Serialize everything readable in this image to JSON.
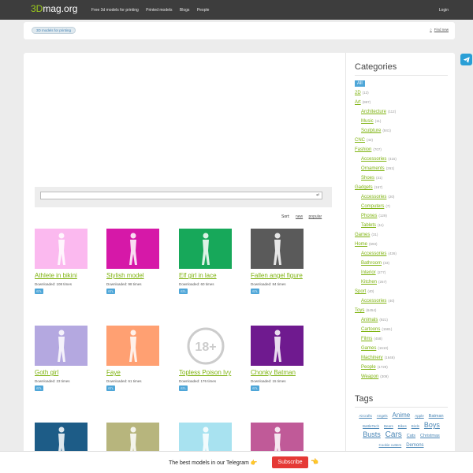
{
  "header": {
    "logo_prefix": "3D",
    "logo_rest": "mag.org",
    "nav": [
      "Free 3d models for printing",
      "Printed models",
      "Blogs",
      "People"
    ],
    "login": "Login"
  },
  "breadcrumb": {
    "item": "3D models for printing",
    "find_new": "Find new"
  },
  "search": {
    "placeholder": ""
  },
  "sort": {
    "label": "Sort:",
    "options": [
      "new",
      "popular"
    ]
  },
  "cards": [
    {
      "title": "Athlete in bikini",
      "downloads": "Downloaded: 108 times",
      "badge": "STL",
      "color": "#fbb9ef",
      "icon": "figure"
    },
    {
      "title": "Stylish model",
      "downloads": "Downloaded: 98 times",
      "badge": "STL",
      "color": "#d618a8",
      "icon": "figure"
    },
    {
      "title": "Elf girl in lace",
      "downloads": "Downloaded: 60 times",
      "badge": "STL",
      "color": "#17a85a",
      "icon": "figure"
    },
    {
      "title": "Fallen angel figure",
      "downloads": "Downloaded: 84 times",
      "badge": "STL",
      "color": "#5a5a5a",
      "icon": "figure"
    },
    {
      "title": "Goth girl",
      "downloads": "Downloaded: 23 times",
      "badge": "STL",
      "color": "#b4a8e0",
      "icon": "figure"
    },
    {
      "title": "Faye",
      "downloads": "Downloaded: 61 times",
      "badge": "STL",
      "color": "#ffa072",
      "icon": "figure"
    },
    {
      "title": "Topless Poison Ivy",
      "downloads": "Downloaded: 176 times",
      "badge": "STL",
      "color": "#ffffff",
      "icon": "18plus"
    },
    {
      "title": "Chonky Batman",
      "downloads": "Downloaded: 15 times",
      "badge": "STL",
      "color": "#6f1a8f",
      "icon": "figure"
    },
    {
      "title": "",
      "downloads": "",
      "badge": "",
      "color": "#1d5c87",
      "icon": "figure"
    },
    {
      "title": "",
      "downloads": "",
      "badge": "",
      "color": "#b7b57d",
      "icon": "figure"
    },
    {
      "title": "",
      "downloads": "",
      "badge": "",
      "color": "#a8e2f0",
      "icon": "figure"
    },
    {
      "title": "",
      "downloads": "",
      "badge": "",
      "color": "#c05a98",
      "icon": "figure"
    }
  ],
  "age_badge": "18+",
  "categories": {
    "title": "Categories",
    "items": [
      {
        "name": "All",
        "count": "",
        "level": 1,
        "all": true
      },
      {
        "name": "2D",
        "count": "(12)",
        "level": 1
      },
      {
        "name": "Art",
        "count": "(987)",
        "level": 1
      },
      {
        "name": "Architecture",
        "count": "(112)",
        "level": 2
      },
      {
        "name": "Music",
        "count": "(11)",
        "level": 2
      },
      {
        "name": "Sculpture",
        "count": "(841)",
        "level": 2
      },
      {
        "name": "CNC",
        "count": "(42)",
        "level": 1
      },
      {
        "name": "Fashion",
        "count": "(707)",
        "level": 1
      },
      {
        "name": "Accessories",
        "count": "(415)",
        "level": 2
      },
      {
        "name": "Ornaments",
        "count": "(261)",
        "level": 2
      },
      {
        "name": "Shoes",
        "count": "(31)",
        "level": 2
      },
      {
        "name": "Gadgets",
        "count": "(167)",
        "level": 1
      },
      {
        "name": "Accessories",
        "count": "(20)",
        "level": 2
      },
      {
        "name": "Computers",
        "count": "(7)",
        "level": 2
      },
      {
        "name": "Phones",
        "count": "(129)",
        "level": 2
      },
      {
        "name": "Tablets",
        "count": "(11)",
        "level": 2
      },
      {
        "name": "Games",
        "count": "(31)",
        "level": 1
      },
      {
        "name": "Home",
        "count": "(693)",
        "level": 1
      },
      {
        "name": "Accessories",
        "count": "(426)",
        "level": 2
      },
      {
        "name": "Bathroom",
        "count": "(33)",
        "level": 2
      },
      {
        "name": "Interior",
        "count": "(277)",
        "level": 2
      },
      {
        "name": "Kitchen",
        "count": "(257)",
        "level": 2
      },
      {
        "name": "Sport",
        "count": "(40)",
        "level": 1
      },
      {
        "name": "Accessories",
        "count": "(40)",
        "level": 2
      },
      {
        "name": "Toys",
        "count": "(6454)",
        "level": 1
      },
      {
        "name": "Animals",
        "count": "(921)",
        "level": 2
      },
      {
        "name": "Cartoons",
        "count": "(1581)",
        "level": 2
      },
      {
        "name": "Films",
        "count": "(458)",
        "level": 2
      },
      {
        "name": "Games",
        "count": "(1610)",
        "level": 2
      },
      {
        "name": "Machinery",
        "count": "(1646)",
        "level": 2
      },
      {
        "name": "People",
        "count": "(1729)",
        "level": 2
      },
      {
        "name": "Weapon",
        "count": "(309)",
        "level": 2
      }
    ]
  },
  "tags": {
    "title": "Tags",
    "items": [
      {
        "name": "Aircrafts",
        "size": 4.5
      },
      {
        "name": "Angels",
        "size": 4.5
      },
      {
        "name": "Anime",
        "size": 8
      },
      {
        "name": "Apple",
        "size": 4.5
      },
      {
        "name": "Batman",
        "size": 5.5
      },
      {
        "name": "BattleTech",
        "size": 4.5
      },
      {
        "name": "Bears",
        "size": 4.5
      },
      {
        "name": "Bikes",
        "size": 4.5
      },
      {
        "name": "Birds",
        "size": 4.5
      },
      {
        "name": "Boys",
        "size": 9
      },
      {
        "name": "Busts",
        "size": 9
      },
      {
        "name": "Cars",
        "size": 10
      },
      {
        "name": "Cats",
        "size": 5.5
      },
      {
        "name": "Christmas",
        "size": 5.5
      },
      {
        "name": "Cookie cutters",
        "size": 4.5
      },
      {
        "name": "Demons",
        "size": 6
      }
    ]
  },
  "banner": {
    "text": "The best models in our Telegram 👉",
    "button": "Subscribe",
    "hand": "👈"
  },
  "colors": {
    "accent_green": "#7fb311",
    "badge_blue": "#4ea6d8",
    "subscribe_red": "#e53935",
    "telegram_blue": "#2a9fd6"
  }
}
